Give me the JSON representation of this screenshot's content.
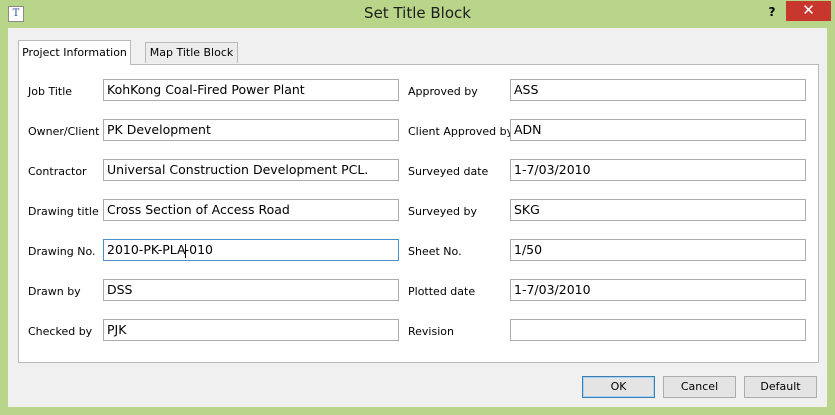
{
  "window": {
    "title": "Set Title Block",
    "help_glyph": "?",
    "close_glyph": "✕",
    "app_icon_glyph": "T"
  },
  "tabs": [
    {
      "label": "Project Information",
      "active": true
    },
    {
      "label": "Map Title Block",
      "active": false
    }
  ],
  "left_fields": [
    {
      "label": "Job Title",
      "value": "KohKong Coal-Fired Power Plant"
    },
    {
      "label": "Owner/Client",
      "value": "PK Development"
    },
    {
      "label": "Contractor",
      "value": "Universal Construction Development PCL."
    },
    {
      "label": "Drawing title",
      "value": "Cross Section of Access Road"
    },
    {
      "label": "Drawing No.",
      "value_before_caret": "2010-PK-PLA",
      "value_after_caret": "-010",
      "focused": true
    },
    {
      "label": "Drawn by",
      "value": "DSS"
    },
    {
      "label": "Checked by",
      "value": "PJK"
    }
  ],
  "right_fields": [
    {
      "label": "Approved by",
      "value": "ASS"
    },
    {
      "label": "Client Approved by",
      "value": "ADN"
    },
    {
      "label": "Surveyed date",
      "value": "1-7/03/2010"
    },
    {
      "label": "Surveyed by",
      "value": "SKG"
    },
    {
      "label": "Sheet No.",
      "value": "1/50"
    },
    {
      "label": "Plotted date",
      "value": "1-7/03/2010"
    },
    {
      "label": "Revision",
      "value": ""
    }
  ],
  "buttons": {
    "ok": "OK",
    "cancel": "Cancel",
    "default": "Default"
  },
  "colors": {
    "frame": "#b9d58a",
    "close_button": "#c7372e",
    "focus_border": "#4d8fc7"
  }
}
